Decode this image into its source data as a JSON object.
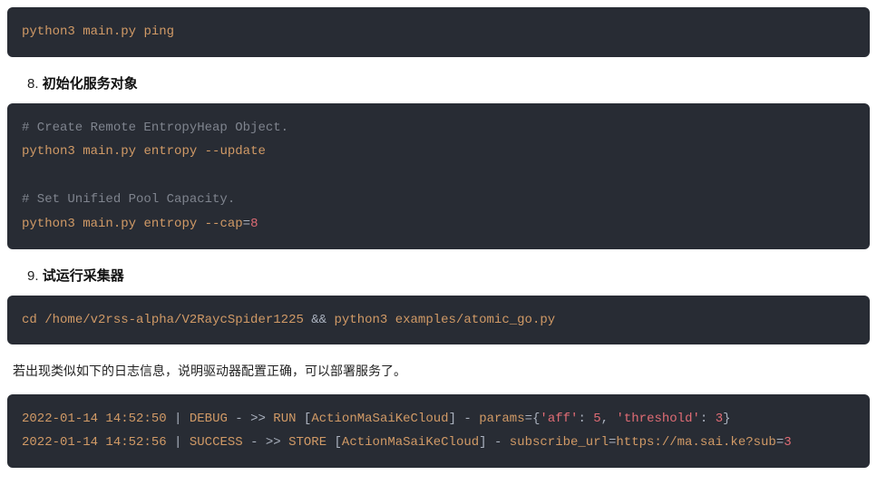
{
  "blocks": {
    "ping": {
      "cmd_py": "python3",
      "cmd_main": "main.py",
      "cmd_sub": "ping"
    },
    "entropy": {
      "comment1": "# Create Remote EntropyHeap Object.",
      "cmd1_py": "python3",
      "cmd1_main": "main.py",
      "cmd1_sub": "entropy",
      "cmd1_flag": "--update",
      "comment2": "# Set Unified Pool Capacity.",
      "cmd2_py": "python3",
      "cmd2_main": "main.py",
      "cmd2_sub": "entropy",
      "cmd2_flag": "--cap",
      "cmd2_eq": "=",
      "cmd2_val": "8"
    },
    "run_example": {
      "cd": "cd",
      "path": "/home/v2rss-alpha/V2RaycSpider1225",
      "and": "&&",
      "py": "python3",
      "script": "examples/atomic_go.py"
    },
    "log": {
      "l1_ts": "2022-01-14 14:52:50",
      "l1_pipe1": " | ",
      "l1_level": "DEBUG",
      "l1_sep": " - >> ",
      "l1_action": "RUN",
      "l1_actor_open": " [",
      "l1_actor": "ActionMaSaiKeCloud",
      "l1_actor_close": "]",
      "l1_dash": " - ",
      "l1_params_key": "params",
      "l1_eq": "=",
      "l1_brace_open": "{",
      "l1_k1": "'aff'",
      "l1_colon1": ": ",
      "l1_v1": "5",
      "l1_comma": ", ",
      "l1_k2": "'threshold'",
      "l1_colon2": ": ",
      "l1_v2": "3",
      "l1_brace_close": "}",
      "l2_ts": "2022-01-14 14:52:56",
      "l2_pipe1": " | ",
      "l2_level": "SUCCESS",
      "l2_sep": " - >> ",
      "l2_action": "STORE",
      "l2_actor_open": " [",
      "l2_actor": "ActionMaSaiKeCloud",
      "l2_actor_close": "]",
      "l2_dash": " - ",
      "l2_key": "subscribe_url",
      "l2_eq": "=",
      "l2_url_a": "https://ma.sai.ke?sub",
      "l2_url_eq": "=",
      "l2_url_b": "3"
    }
  },
  "steps": {
    "s8_num": "8. ",
    "s8_title": "初始化服务对象",
    "s9_num": "9. ",
    "s9_title": "试运行采集器"
  },
  "text": {
    "after9": "若出现类似如下的日志信息，说明驱动器配置正确，可以部署服务了。"
  }
}
